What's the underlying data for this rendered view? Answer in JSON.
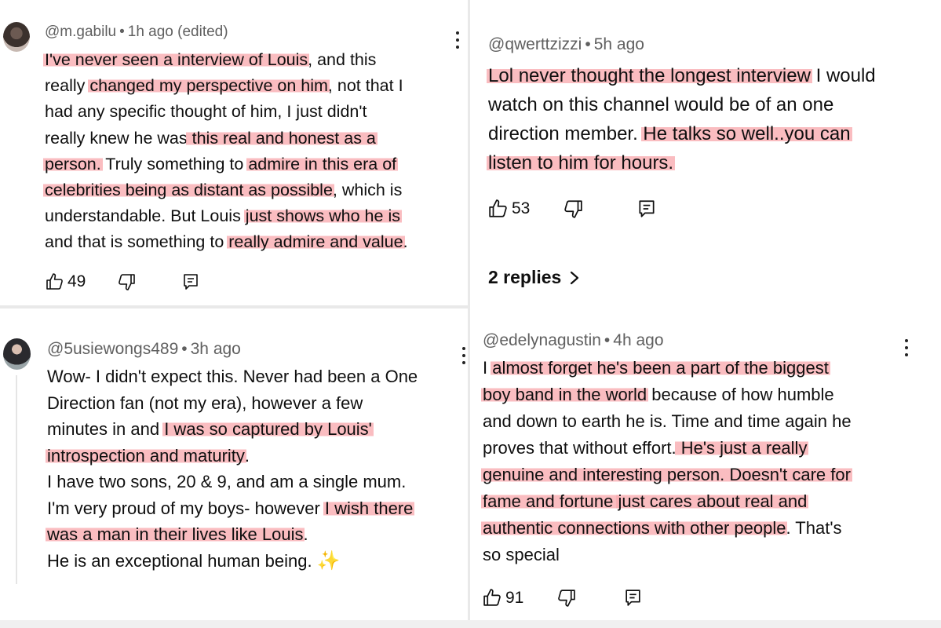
{
  "comments": [
    {
      "handle": "@m.gabilu",
      "time": "1h ago (edited)",
      "lines": [
        [
          {
            "t": "I've never seen a interview of Louis",
            "h": true
          },
          {
            "t": ", and this",
            "h": false
          }
        ],
        [
          {
            "t": "really ",
            "h": false
          },
          {
            "t": "changed my perspective on him",
            "h": true
          },
          {
            "t": ", not that I",
            "h": false
          }
        ],
        [
          {
            "t": "had any specific thought of him, I just didn't",
            "h": false
          }
        ],
        [
          {
            "t": "really knew he was",
            "h": false
          },
          {
            "t": " this real and honest as a",
            "h": true
          }
        ],
        [
          {
            "t": "person.",
            "h": true
          },
          {
            "t": " Truly something to ",
            "h": false
          },
          {
            "t": "admire in this era of",
            "h": true
          }
        ],
        [
          {
            "t": "celebrities being as distant as possible",
            "h": true
          },
          {
            "t": ", which is",
            "h": false
          }
        ],
        [
          {
            "t": "understandable. But Louis ",
            "h": false
          },
          {
            "t": "just shows who he is",
            "h": true
          }
        ],
        [
          {
            "t": "and that is something to ",
            "h": false
          },
          {
            "t": "really admire and value",
            "h": true
          },
          {
            "t": ".",
            "h": false
          }
        ]
      ],
      "likes": "49"
    },
    {
      "handle": "@qwerttzizzi",
      "time": "5h ago",
      "lines": [
        [
          {
            "t": "Lol never thought the longest interview",
            "h": true
          },
          {
            "t": " I would",
            "h": false
          }
        ],
        [
          {
            "t": "watch on this channel would be of an one",
            "h": false
          }
        ],
        [
          {
            "t": "direction member. ",
            "h": false
          },
          {
            "t": "He talks so well..you can",
            "h": true
          }
        ],
        [
          {
            "t": "listen to him for hours.",
            "h": true
          }
        ]
      ],
      "likes": "53",
      "replies": "2 replies"
    },
    {
      "handle": "@5usiewongs489",
      "time": "3h ago",
      "lines": [
        [
          {
            "t": "Wow- I didn't expect this. Never had been a One",
            "h": false
          }
        ],
        [
          {
            "t": "Direction fan (not my era), however a few",
            "h": false
          }
        ],
        [
          {
            "t": "minutes in and ",
            "h": false
          },
          {
            "t": "I was so captured by Louis'",
            "h": true
          }
        ],
        [
          {
            "t": "introspection and maturity",
            "h": true
          },
          {
            "t": ".",
            "h": false
          }
        ],
        [
          {
            "t": "I have two sons, 20 & 9, and am a single mum.",
            "h": false
          }
        ],
        [
          {
            "t": "I'm very proud of my boys- however ",
            "h": false
          },
          {
            "t": "I wish there",
            "h": true
          }
        ],
        [
          {
            "t": "was a man in their lives like Louis",
            "h": true
          },
          {
            "t": ".",
            "h": false
          }
        ],
        [
          {
            "t": "He is an exceptional human being. ",
            "h": false
          },
          {
            "t": "✨",
            "h": false,
            "s": true
          }
        ]
      ]
    },
    {
      "handle": "@edelynagustin",
      "time": "4h ago",
      "lines": [
        [
          {
            "t": "I ",
            "h": false
          },
          {
            "t": "almost forget he's been a part of the biggest",
            "h": true
          }
        ],
        [
          {
            "t": "boy band in the world",
            "h": true
          },
          {
            "t": " because of how humble",
            "h": false
          }
        ],
        [
          {
            "t": "and down to earth he is. Time and time again he",
            "h": false
          }
        ],
        [
          {
            "t": "proves that without effort.",
            "h": false
          },
          {
            "t": " He's just a really",
            "h": true
          }
        ],
        [
          {
            "t": "genuine and interesting person. Doesn't care for",
            "h": true
          }
        ],
        [
          {
            "t": "fame and fortune ",
            "h": true
          },
          {
            "t": "just cares about real and",
            "h": true
          }
        ],
        [
          {
            "t": "authentic connections with other people",
            "h": true
          },
          {
            "t": ". That's",
            "h": false
          }
        ],
        [
          {
            "t": "so special",
            "h": false
          }
        ]
      ],
      "likes": "91"
    }
  ],
  "icons": [
    "thumbs-up-icon",
    "thumbs-down-icon",
    "reply-icon",
    "more-vert-icon",
    "chevron-right-icon"
  ],
  "colors": {
    "highlight": "#f8aaaf",
    "meta": "#606060",
    "text": "#0f0f0f"
  }
}
